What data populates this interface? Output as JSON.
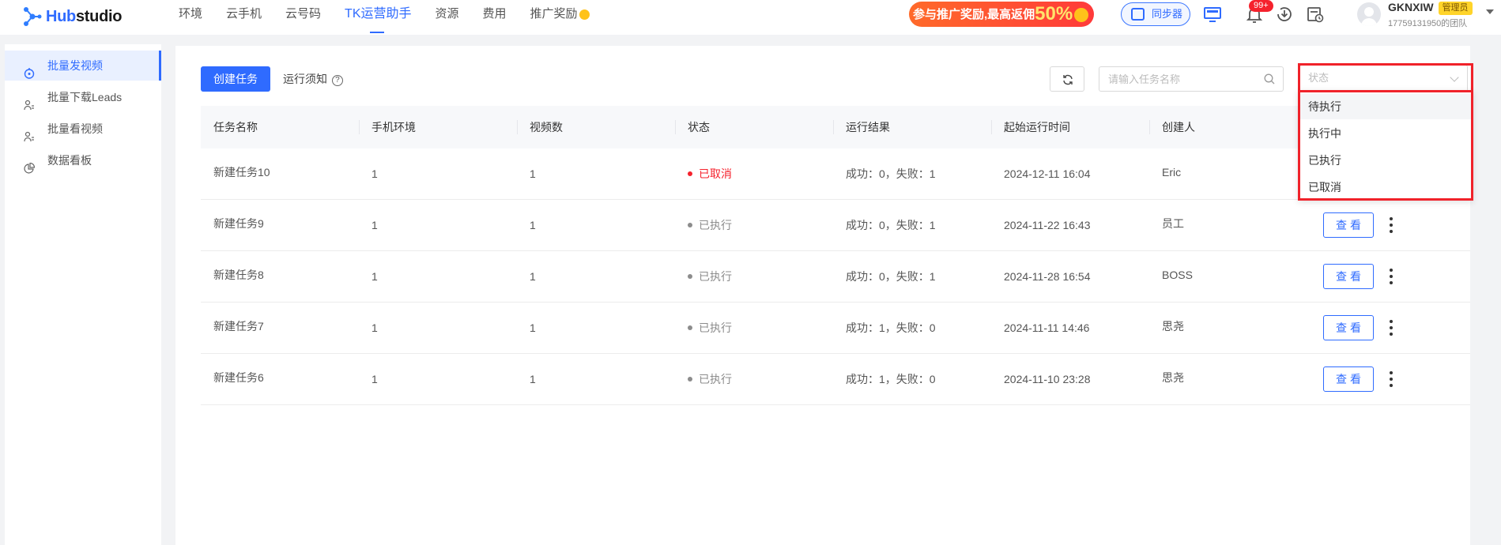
{
  "app": {
    "logo_prefix": "Hub",
    "logo_suffix": "studio"
  },
  "nav": {
    "items": [
      {
        "label": "环境"
      },
      {
        "label": "云手机"
      },
      {
        "label": "云号码"
      },
      {
        "label": "TK运营助手"
      },
      {
        "label": "资源"
      },
      {
        "label": "费用"
      },
      {
        "label": "推广奖励"
      }
    ],
    "active_index": 3
  },
  "promo": {
    "text": "参与推广奖励,最高返佣",
    "percent": "50%"
  },
  "toolbar": {
    "sync_label": "同步器",
    "notification_badge": "99+"
  },
  "user": {
    "name": "GKNXIW",
    "role": "管理员",
    "team": "17759131950的团队"
  },
  "sidebar": {
    "items": [
      {
        "label": "批量发视频"
      },
      {
        "label": "批量下载Leads"
      },
      {
        "label": "批量看视频"
      },
      {
        "label": "数据看板"
      }
    ]
  },
  "main": {
    "create_label": "创建任务",
    "notice_label": "运行须知",
    "search_placeholder": "请输入任务名称",
    "status_placeholder": "状态"
  },
  "table": {
    "headers": [
      "任务名称",
      "手机环境",
      "视频数",
      "状态",
      "运行结果",
      "起始运行时间",
      "创建人"
    ],
    "view_label": "查看",
    "rows": [
      {
        "name": "新建任务10",
        "env": "1",
        "videos": "1",
        "status": "已取消",
        "result": "成功：0，失败：1",
        "time": "2024-12-11 16:04",
        "creator": "Eric"
      },
      {
        "name": "新建任务9",
        "env": "1",
        "videos": "1",
        "status": "已执行",
        "result": "成功：0，失败：1",
        "time": "2024-11-22 16:43",
        "creator": "员工"
      },
      {
        "name": "新建任务8",
        "env": "1",
        "videos": "1",
        "status": "已执行",
        "result": "成功：0，失败：1",
        "time": "2024-11-28 16:54",
        "creator": "BOSS"
      },
      {
        "name": "新建任务7",
        "env": "1",
        "videos": "1",
        "status": "已执行",
        "result": "成功：1，失败：0",
        "time": "2024-11-11 14:46",
        "creator": "思尧"
      },
      {
        "name": "新建任务6",
        "env": "1",
        "videos": "1",
        "status": "已执行",
        "result": "成功：1，失败：0",
        "time": "2024-11-10 23:28",
        "creator": "思尧"
      }
    ]
  },
  "status_dropdown": {
    "options": [
      "待执行",
      "执行中",
      "已执行",
      "已取消"
    ]
  },
  "colors": {
    "accent": "#2f6bff",
    "cancelled": "#f5222d",
    "executed": "#8c8c8c",
    "highlight": "#f0222a"
  }
}
